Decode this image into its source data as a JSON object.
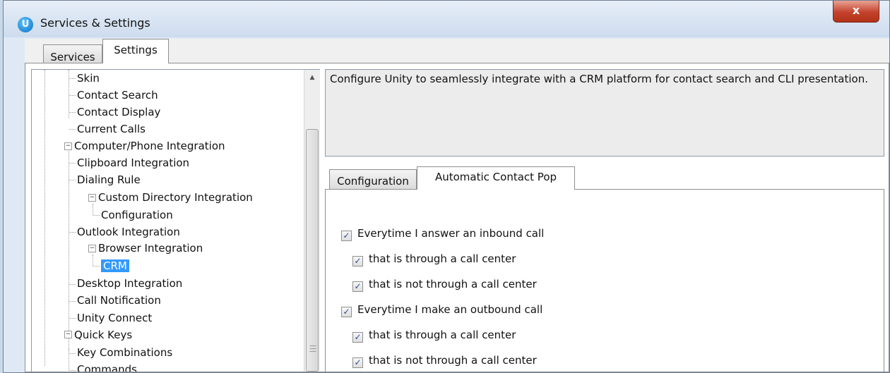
{
  "window": {
    "title": "Services & Settings",
    "app_icon_letter": "U",
    "close_symbol": "x"
  },
  "tabs": {
    "services": "Services",
    "settings": "Settings"
  },
  "tree": [
    {
      "label": "Skin"
    },
    {
      "label": "Contact Search"
    },
    {
      "label": "Contact Display"
    },
    {
      "label": "Current Calls"
    },
    {
      "label": "Computer/Phone Integration"
    },
    {
      "label": "Clipboard Integration"
    },
    {
      "label": "Dialing Rule"
    },
    {
      "label": "Custom Directory Integration"
    },
    {
      "label": "Configuration"
    },
    {
      "label": "Outlook Integration"
    },
    {
      "label": "Browser Integration"
    },
    {
      "label": "CRM"
    },
    {
      "label": "Desktop Integration"
    },
    {
      "label": "Call Notification"
    },
    {
      "label": "Unity Connect"
    },
    {
      "label": "Quick Keys"
    },
    {
      "label": "Key Combinations"
    },
    {
      "label": "Commands"
    }
  ],
  "description": "Configure Unity to seamlessly integrate with a CRM platform for contact search and CLI presentation.",
  "inner_tabs": {
    "configuration": "Configuration",
    "automatic_contact_pop": "Automatic Contact Pop"
  },
  "options": {
    "inbound": {
      "label": "Everytime I answer an inbound call",
      "checked": true
    },
    "inbound_cc": {
      "label": "that is through a call center",
      "checked": true
    },
    "inbound_not_cc": {
      "label": "that is not through a call center",
      "checked": true
    },
    "outbound": {
      "label": "Everytime I make an outbound call",
      "checked": true
    },
    "outbound_cc": {
      "label": "that is through a call center",
      "checked": true
    },
    "outbound_not_cc": {
      "label": "that is not through a call center",
      "checked": true
    }
  },
  "colors": {
    "selection": "#3399ff",
    "close_button": "#c4412c"
  }
}
